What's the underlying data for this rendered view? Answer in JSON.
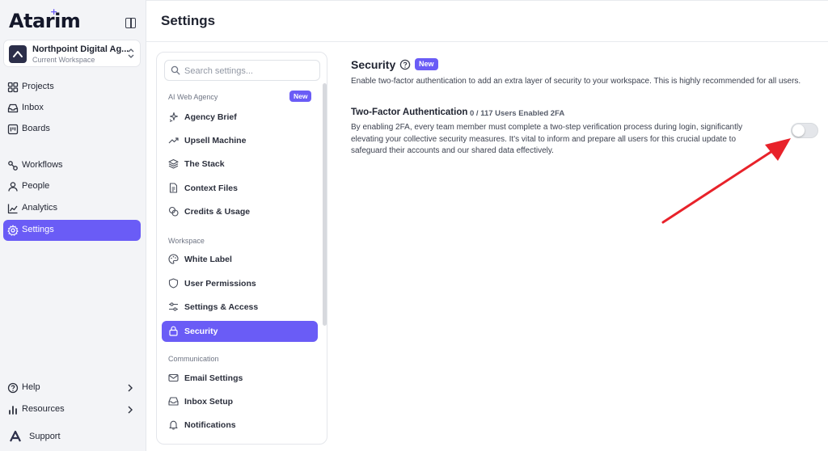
{
  "app": {
    "logo": "Atarim",
    "workspace": {
      "name": "Northpoint Digital Ag...",
      "subtitle": "Current Workspace"
    },
    "nav": [
      {
        "label": "Projects",
        "icon": "grid-icon"
      },
      {
        "label": "Inbox",
        "icon": "inbox-icon"
      },
      {
        "label": "Boards",
        "icon": "board-icon"
      },
      {
        "label": "Workflows",
        "icon": "workflow-icon"
      },
      {
        "label": "People",
        "icon": "person-icon"
      },
      {
        "label": "Analytics",
        "icon": "chart-icon"
      },
      {
        "label": "Settings",
        "icon": "gear-icon",
        "active": true
      }
    ],
    "bottom_nav": [
      {
        "label": "Help",
        "icon": "help-circle-icon"
      },
      {
        "label": "Resources",
        "icon": "bar-chart-icon"
      }
    ],
    "support_label": "Support"
  },
  "header": {
    "title": "Settings"
  },
  "settings_nav": {
    "search_placeholder": "Search settings...",
    "sections": [
      {
        "title": "AI Web Agency",
        "badge": "New",
        "items": [
          "Agency Brief",
          "Upsell Machine",
          "The Stack",
          "Context Files",
          "Credits & Usage"
        ]
      },
      {
        "title": "Workspace",
        "items": [
          "White Label",
          "User Permissions",
          "Settings & Access",
          "Security"
        ]
      },
      {
        "title": "Communication",
        "items": [
          "Email Settings",
          "Inbox Setup",
          "Notifications"
        ]
      }
    ],
    "active_item": "Security"
  },
  "security": {
    "title": "Security",
    "badge": "New",
    "description": "Enable two-factor authentication to add an extra layer of security to your workspace. This is highly recommended for all users.",
    "tfa": {
      "title": "Two-Factor Authentication",
      "count": "0 / 117 Users Enabled 2FA",
      "description": "By enabling 2FA, every team member must complete a two-step verification process during login, significantly elevating your collective security measures. It's vital to inform and prepare all users for this crucial update to safeguard their accounts and our shared data effectively.",
      "enabled": false
    }
  },
  "colors": {
    "accent": "#6a5cf6",
    "annotation_arrow": "#e8222a"
  }
}
